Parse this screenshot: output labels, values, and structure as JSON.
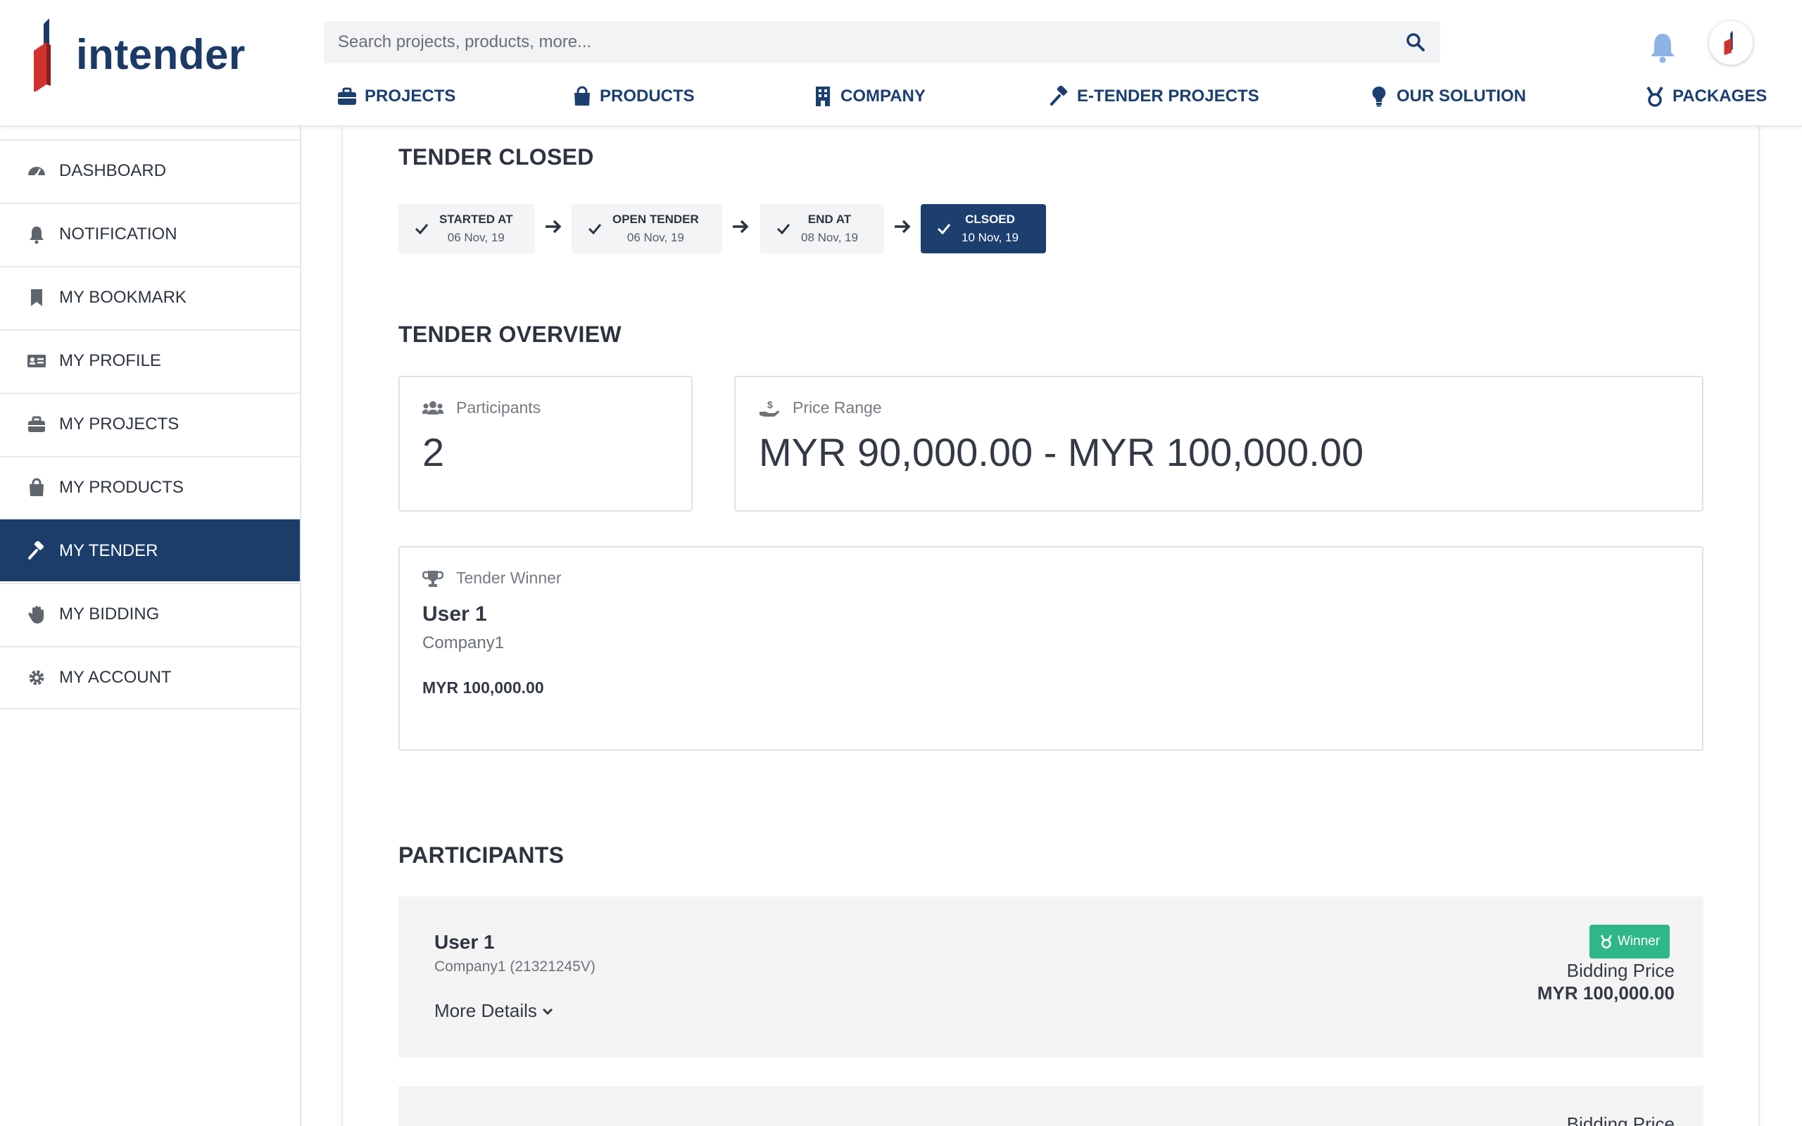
{
  "brand": {
    "name": "intender"
  },
  "search": {
    "placeholder": "Search projects, products, more..."
  },
  "nav": {
    "items": [
      {
        "label": "PROJECTS",
        "icon": "briefcase-icon"
      },
      {
        "label": "PRODUCTS",
        "icon": "shopping-bag-icon"
      },
      {
        "label": "COMPANY",
        "icon": "building-icon"
      },
      {
        "label": "E-TENDER PROJECTS",
        "icon": "gavel-icon"
      },
      {
        "label": "OUR SOLUTION",
        "icon": "lightbulb-icon"
      },
      {
        "label": "PACKAGES",
        "icon": "medal-icon"
      }
    ]
  },
  "sidebar": {
    "items": [
      {
        "label": "DASHBOARD",
        "icon": "dashboard-icon"
      },
      {
        "label": "NOTIFICATION",
        "icon": "bell-icon"
      },
      {
        "label": "MY BOOKMARK",
        "icon": "bookmark-icon"
      },
      {
        "label": "MY PROFILE",
        "icon": "id-card-icon"
      },
      {
        "label": "MY PROJECTS",
        "icon": "briefcase-icon"
      },
      {
        "label": "MY PRODUCTS",
        "icon": "shopping-bag-icon"
      },
      {
        "label": "MY TENDER",
        "icon": "gavel-icon",
        "active": true
      },
      {
        "label": "MY BIDDING",
        "icon": "hand-icon"
      },
      {
        "label": "MY ACCOUNT",
        "icon": "gear-icon"
      }
    ]
  },
  "status": {
    "title": "TENDER CLOSED",
    "steps": [
      {
        "label": "STARTED AT",
        "date": "06 Nov, 19"
      },
      {
        "label": "OPEN TENDER",
        "date": "06 Nov, 19"
      },
      {
        "label": "END AT",
        "date": "08 Nov, 19"
      },
      {
        "label": "CLSOED",
        "date": "10 Nov, 19",
        "active": true
      }
    ]
  },
  "overview": {
    "title": "TENDER OVERVIEW",
    "participants_label": "Participants",
    "participants_value": "2",
    "price_label": "Price Range",
    "price_value": "MYR 90,000.00 - MYR 100,000.00",
    "winner_label": "Tender Winner",
    "winner_name": "User 1",
    "winner_company": "Company1",
    "winner_price": "MYR 100,000.00"
  },
  "participants": {
    "title": "PARTICIPANTS",
    "items": [
      {
        "name": "User 1",
        "company": "Company1 (21321245V)",
        "more": "More Details",
        "badge": "Winner",
        "bid_label": "Bidding Price",
        "bid_value": "MYR 100,000.00"
      },
      {
        "bid_label": "Bidding Price"
      }
    ]
  },
  "colors": {
    "primary": "#1c3f70",
    "accent_red": "#d0312d",
    "winner_green": "#2fb787",
    "bell_blue": "#8fb3e6"
  }
}
